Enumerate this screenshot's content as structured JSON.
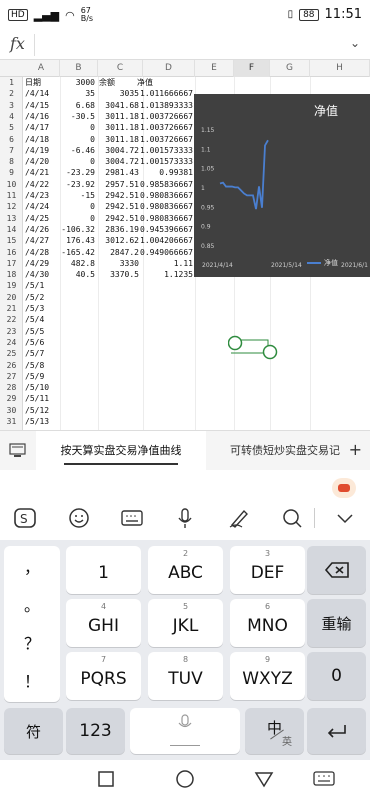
{
  "status": {
    "carrier": "HD",
    "net_speed_top": "67",
    "net_speed_unit": "B/s",
    "battery": "88",
    "time": "11:51"
  },
  "formula": {
    "fx": "fx"
  },
  "columns": [
    "A",
    "B",
    "C",
    "D",
    "E",
    "F",
    "G",
    "H"
  ],
  "selected_column": "F",
  "rows": [
    {
      "n": "1",
      "a": "日期",
      "b": "3000",
      "c": "余额",
      "d": "净值"
    },
    {
      "n": "2",
      "a": "/4/14",
      "b": "35",
      "c": "3035",
      "d": "1.011666667"
    },
    {
      "n": "3",
      "a": "/4/15",
      "b": "6.68",
      "c": "3041.68",
      "d": "1.013893333"
    },
    {
      "n": "4",
      "a": "/4/16",
      "b": "-30.5",
      "c": "3011.18",
      "d": "1.003726667"
    },
    {
      "n": "5",
      "a": "/4/17",
      "b": "0",
      "c": "3011.18",
      "d": "1.003726667"
    },
    {
      "n": "6",
      "a": "/4/18",
      "b": "0",
      "c": "3011.18",
      "d": "1.003726667"
    },
    {
      "n": "7",
      "a": "/4/19",
      "b": "-6.46",
      "c": "3004.72",
      "d": "1.001573333"
    },
    {
      "n": "8",
      "a": "/4/20",
      "b": "0",
      "c": "3004.72",
      "d": "1.001573333"
    },
    {
      "n": "9",
      "a": "/4/21",
      "b": "-23.29",
      "c": "2981.43",
      "d": "0.99381"
    },
    {
      "n": "10",
      "a": "/4/22",
      "b": "-23.92",
      "c": "2957.51",
      "d": "0.985836667"
    },
    {
      "n": "11",
      "a": "/4/23",
      "b": "-15",
      "c": "2942.51",
      "d": "0.980836667"
    },
    {
      "n": "12",
      "a": "/4/24",
      "b": "0",
      "c": "2942.51",
      "d": "0.980836667"
    },
    {
      "n": "13",
      "a": "/4/25",
      "b": "0",
      "c": "2942.51",
      "d": "0.980836667"
    },
    {
      "n": "14",
      "a": "/4/26",
      "b": "-106.32",
      "c": "2836.19",
      "d": "0.945396667"
    },
    {
      "n": "15",
      "a": "/4/27",
      "b": "176.43",
      "c": "3012.62",
      "d": "1.004206667"
    },
    {
      "n": "16",
      "a": "/4/28",
      "b": "-165.42",
      "c": "2847.2",
      "d": "0.949066667"
    },
    {
      "n": "17",
      "a": "/4/29",
      "b": "482.8",
      "c": "3330",
      "d": "1.11"
    },
    {
      "n": "18",
      "a": "/4/30",
      "b": "40.5",
      "c": "3370.5",
      "d": "1.1235"
    },
    {
      "n": "19",
      "a": "/5/1",
      "b": "",
      "c": "",
      "d": ""
    },
    {
      "n": "20",
      "a": "/5/2",
      "b": "",
      "c": "",
      "d": ""
    },
    {
      "n": "21",
      "a": "/5/3",
      "b": "",
      "c": "",
      "d": ""
    },
    {
      "n": "22",
      "a": "/5/4",
      "b": "",
      "c": "",
      "d": ""
    },
    {
      "n": "23",
      "a": "/5/5",
      "b": "",
      "c": "",
      "d": ""
    },
    {
      "n": "24",
      "a": "/5/6",
      "b": "",
      "c": "",
      "d": ""
    },
    {
      "n": "25",
      "a": "/5/7",
      "b": "",
      "c": "",
      "d": ""
    },
    {
      "n": "26",
      "a": "/5/8",
      "b": "",
      "c": "",
      "d": ""
    },
    {
      "n": "27",
      "a": "/5/9",
      "b": "",
      "c": "",
      "d": ""
    },
    {
      "n": "28",
      "a": "/5/10",
      "b": "",
      "c": "",
      "d": ""
    },
    {
      "n": "29",
      "a": "/5/11",
      "b": "",
      "c": "",
      "d": ""
    },
    {
      "n": "30",
      "a": "/5/12",
      "b": "",
      "c": "",
      "d": ""
    },
    {
      "n": "31",
      "a": "/5/13",
      "b": "",
      "c": "",
      "d": ""
    }
  ],
  "chart_data": {
    "type": "line",
    "title": "净值",
    "legend": "净值",
    "legend_position": "bottom",
    "background": "#404040",
    "line_color": "#4a7fd0",
    "yticks": [
      "1.15",
      "1.1",
      "1.05",
      "1",
      "0.95",
      "0.9",
      "0.85"
    ],
    "ylim": [
      0.85,
      1.15
    ],
    "xticks": [
      "2021/4/14",
      "2021/5/14",
      "2021/6/1"
    ],
    "series": [
      {
        "x": [
          "2021/4/14",
          "2021/4/15",
          "2021/4/16",
          "2021/4/17",
          "2021/4/18",
          "2021/4/19",
          "2021/4/20",
          "2021/4/21",
          "2021/4/22",
          "2021/4/23",
          "2021/4/24",
          "2021/4/25",
          "2021/4/26",
          "2021/4/27",
          "2021/4/28",
          "2021/4/29",
          "2021/4/30"
        ],
        "values": [
          1.011666667,
          1.013893333,
          1.003726667,
          1.003726667,
          1.003726667,
          1.001573333,
          1.001573333,
          0.99381,
          0.985836667,
          0.980836667,
          0.980836667,
          0.980836667,
          0.945396667,
          1.004206667,
          0.949066667,
          1.11,
          1.1235
        ]
      }
    ]
  },
  "tabs": {
    "active": "按天算实盘交易净值曲线",
    "other": "可转债短炒实盘交易记",
    "add": "+"
  },
  "keyboard": {
    "left_col": [
      "，",
      "。",
      "？",
      "！"
    ],
    "rows": [
      [
        {
          "num": "",
          "label": "1"
        },
        {
          "num": "2",
          "label": "ABC"
        },
        {
          "num": "3",
          "label": "DEF"
        }
      ],
      [
        {
          "num": "4",
          "label": "GHI"
        },
        {
          "num": "5",
          "label": "JKL"
        },
        {
          "num": "6",
          "label": "MNO"
        }
      ],
      [
        {
          "num": "7",
          "label": "PQRS"
        },
        {
          "num": "8",
          "label": "TUV"
        },
        {
          "num": "9",
          "label": "WXYZ"
        }
      ]
    ],
    "reenter": "重输",
    "zero": "0",
    "symbols": "符",
    "numbers": "123",
    "zh": "中",
    "en": "英"
  }
}
